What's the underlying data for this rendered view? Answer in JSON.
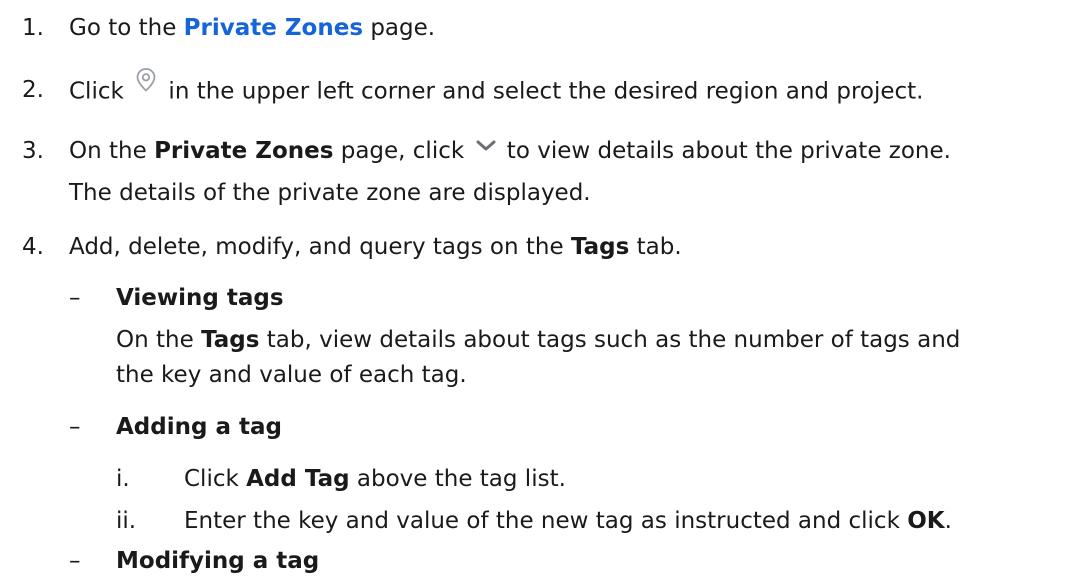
{
  "steps": [
    {
      "num": "1.",
      "pre": "Go to the ",
      "link": "Private Zones",
      "post": " page."
    },
    {
      "num": "2.",
      "pre": "Click ",
      "icon": "location-pin-icon",
      "post": " in the upper left corner and select the desired region and project."
    },
    {
      "num": "3.",
      "pre": "On the ",
      "bold": "Private Zones",
      "mid": " page, click ",
      "icon": "chevron-down-icon",
      "post": " to view details about the private zone.",
      "line2": "The details of the private zone are displayed."
    },
    {
      "num": "4.",
      "pre": "Add, delete, modify, and query tags on the ",
      "bold": "Tags",
      "post": " tab."
    }
  ],
  "substeps": {
    "dash": "–",
    "viewing": {
      "title": "Viewing tags",
      "pre": "On the ",
      "bold": "Tags",
      "post": " tab, view details about tags such as the number of tags and",
      "line2": "the key and value of each tag."
    },
    "adding": {
      "title": "Adding a tag",
      "items": [
        {
          "num": "i.",
          "pre": "Click ",
          "bold": "Add Tag",
          "post": " above the tag list."
        },
        {
          "num": "ii.",
          "pre": "Enter the key and value of the new tag as instructed and click ",
          "bold": "OK",
          "post": "."
        }
      ]
    },
    "modifying": {
      "title": "Modifying a tag"
    }
  },
  "colors": {
    "link": "#1665d8",
    "text": "#1a1a1a",
    "icon": "#9aa0a6",
    "chevron": "#6b6f75"
  }
}
